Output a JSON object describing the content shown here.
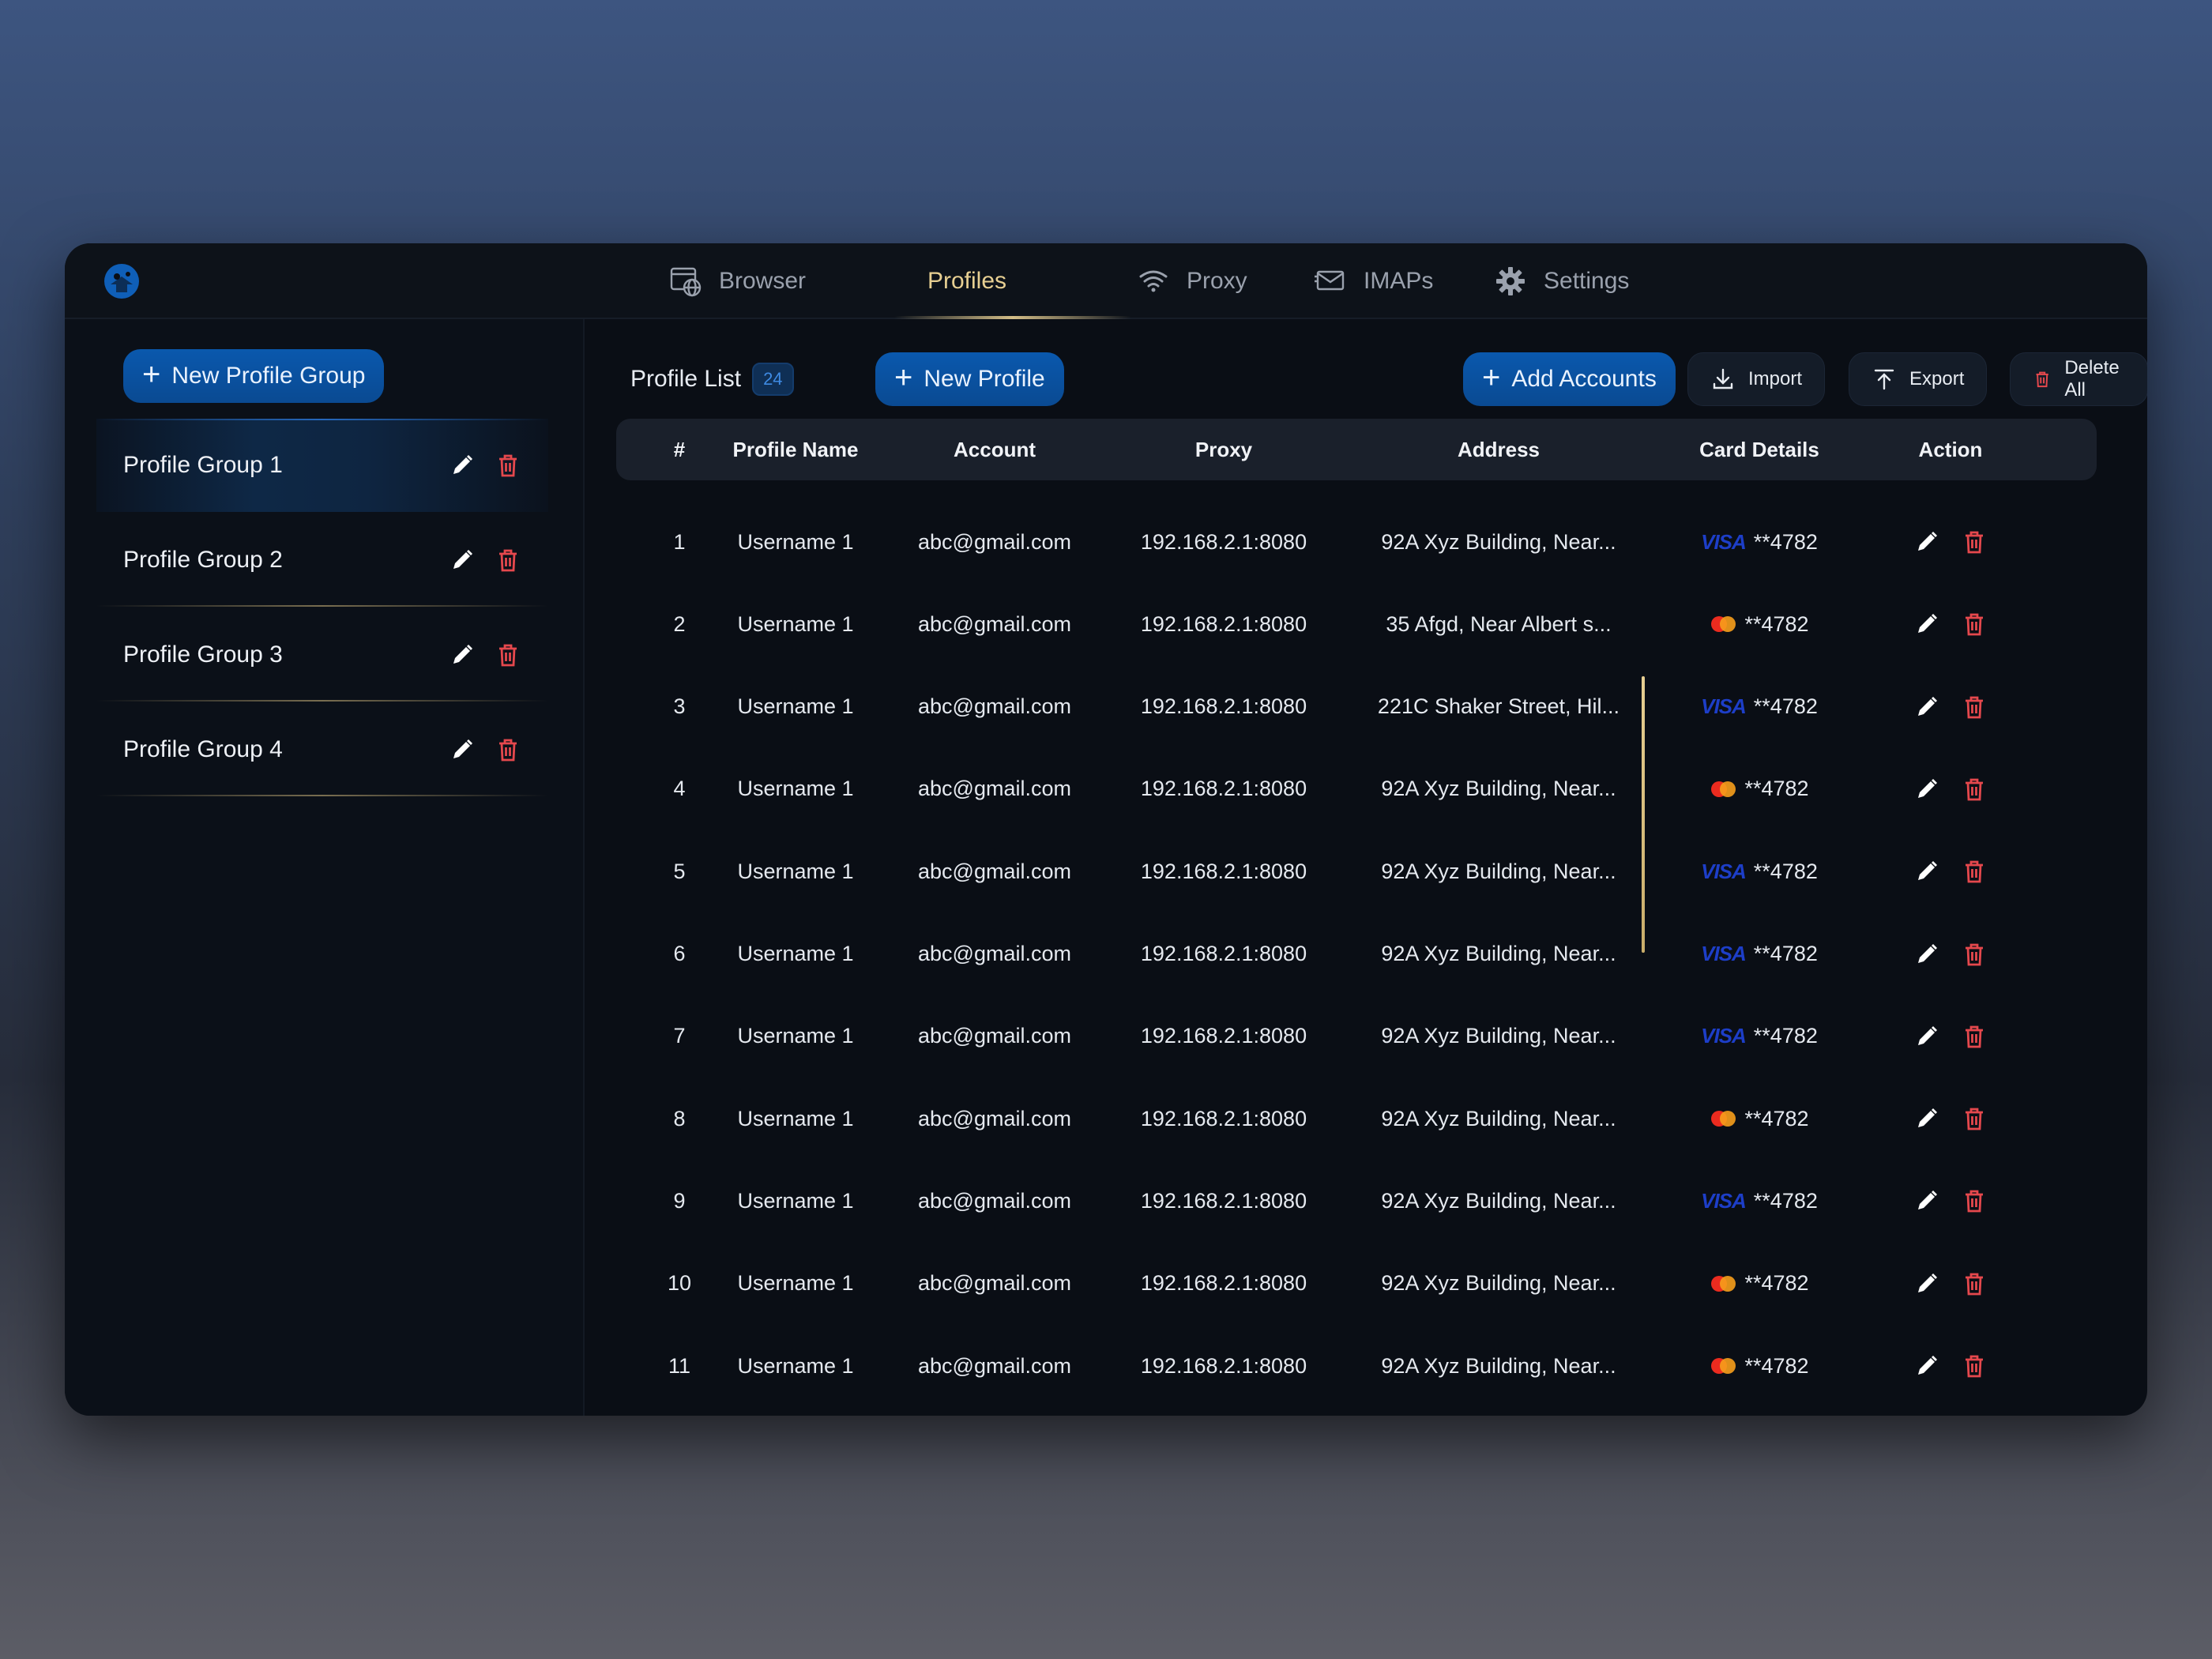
{
  "nav": {
    "tabs": [
      {
        "label": "Browser",
        "icon": "browser-globe-icon"
      },
      {
        "label": "Profiles",
        "icon": ""
      },
      {
        "label": "Proxy",
        "icon": "wifi-icon"
      },
      {
        "label": "IMAPs",
        "icon": "mail-icon"
      },
      {
        "label": "Settings",
        "icon": "gear-icon"
      }
    ],
    "active_tab": "Profiles"
  },
  "sidebar": {
    "new_group_label": "New Profile Group",
    "groups": [
      {
        "label": "Profile Group 1",
        "active": true
      },
      {
        "label": "Profile Group 2",
        "active": false
      },
      {
        "label": "Profile Group 3",
        "active": false
      },
      {
        "label": "Profile Group 4",
        "active": false
      }
    ]
  },
  "main": {
    "list_title": "Profile List",
    "count": "24",
    "new_profile_label": "New Profile",
    "add_accounts_label": "Add Accounts",
    "import_label": "Import",
    "export_label": "Export",
    "delete_all_label": "Delete All",
    "columns": [
      "#",
      "Profile Name",
      "Account",
      "Proxy",
      "Address",
      "Card Details",
      "Action"
    ],
    "rows": [
      {
        "num": "1",
        "name": "Username 1",
        "account": "abc@gmail.com",
        "proxy": "192.168.2.1:8080",
        "address": "92A Xyz Building, Near...",
        "card_brand": "visa",
        "card": "**4782"
      },
      {
        "num": "2",
        "name": "Username 1",
        "account": "abc@gmail.com",
        "proxy": "192.168.2.1:8080",
        "address": "35 Afgd, Near Albert s...",
        "card_brand": "mastercard",
        "card": "**4782"
      },
      {
        "num": "3",
        "name": "Username 1",
        "account": "abc@gmail.com",
        "proxy": "192.168.2.1:8080",
        "address": "221C Shaker Street, Hil...",
        "card_brand": "visa",
        "card": "**4782"
      },
      {
        "num": "4",
        "name": "Username 1",
        "account": "abc@gmail.com",
        "proxy": "192.168.2.1:8080",
        "address": "92A Xyz Building, Near...",
        "card_brand": "mastercard",
        "card": "**4782"
      },
      {
        "num": "5",
        "name": "Username 1",
        "account": "abc@gmail.com",
        "proxy": "192.168.2.1:8080",
        "address": "92A Xyz Building, Near...",
        "card_brand": "visa",
        "card": "**4782"
      },
      {
        "num": "6",
        "name": "Username 1",
        "account": "abc@gmail.com",
        "proxy": "192.168.2.1:8080",
        "address": "92A Xyz Building, Near...",
        "card_brand": "visa",
        "card": "**4782"
      },
      {
        "num": "7",
        "name": "Username 1",
        "account": "abc@gmail.com",
        "proxy": "192.168.2.1:8080",
        "address": "92A Xyz Building, Near...",
        "card_brand": "visa",
        "card": "**4782"
      },
      {
        "num": "8",
        "name": "Username 1",
        "account": "abc@gmail.com",
        "proxy": "192.168.2.1:8080",
        "address": "92A Xyz Building, Near...",
        "card_brand": "mastercard",
        "card": "**4782"
      },
      {
        "num": "9",
        "name": "Username 1",
        "account": "abc@gmail.com",
        "proxy": "192.168.2.1:8080",
        "address": "92A Xyz Building, Near...",
        "card_brand": "visa",
        "card": "**4782"
      },
      {
        "num": "10",
        "name": "Username 1",
        "account": "abc@gmail.com",
        "proxy": "192.168.2.1:8080",
        "address": "92A Xyz Building, Near...",
        "card_brand": "mastercard",
        "card": "**4782"
      },
      {
        "num": "11",
        "name": "Username 1",
        "account": "abc@gmail.com",
        "proxy": "192.168.2.1:8080",
        "address": "92A Xyz Building, Near...",
        "card_brand": "mastercard",
        "card": "**4782"
      }
    ]
  },
  "colors": {
    "accent_blue": "#0a58ad",
    "active_tab_gold": "#e7cf92",
    "delete_red": "#e5484d",
    "visa_blue": "#1d3ec8"
  }
}
